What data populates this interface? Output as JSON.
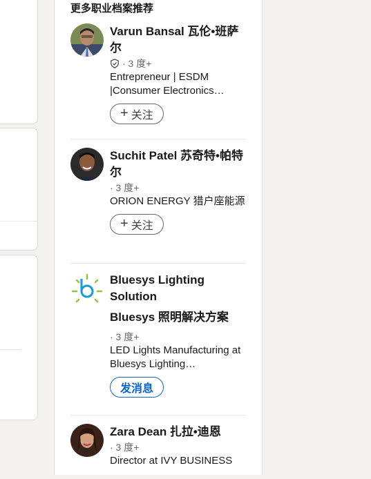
{
  "panel": {
    "title": "更多职业档案推荐"
  },
  "people": [
    {
      "name": "Varun Bansal  瓦伦•班萨尔",
      "degree": "· 3 度+",
      "headline": "Entrepreneur | ESDM |Consumer Electronics…",
      "action": "关注",
      "verified": true
    },
    {
      "name": "Suchit Patel  苏奇特•帕特尔",
      "degree": "· 3 度+",
      "headline": "ORION ENERGY  猎户座能源",
      "action": "关注"
    },
    {
      "name": "Bluesys Lighting Solution",
      "name_cn": "Bluesys 照明解决方案",
      "degree": "· 3 度+",
      "headline": "LED Lights Manufacturing at Bluesys Lighting…",
      "action": "发消息"
    },
    {
      "name": "Zara Dean  扎拉•迪恩",
      "degree": "· 3 度+",
      "headline": "Director at IVY BUSINESS"
    }
  ],
  "colors": {
    "accent": "#0a66c2",
    "logo_blue": "#1a9ad6",
    "logo_green": "#8cc63f"
  }
}
